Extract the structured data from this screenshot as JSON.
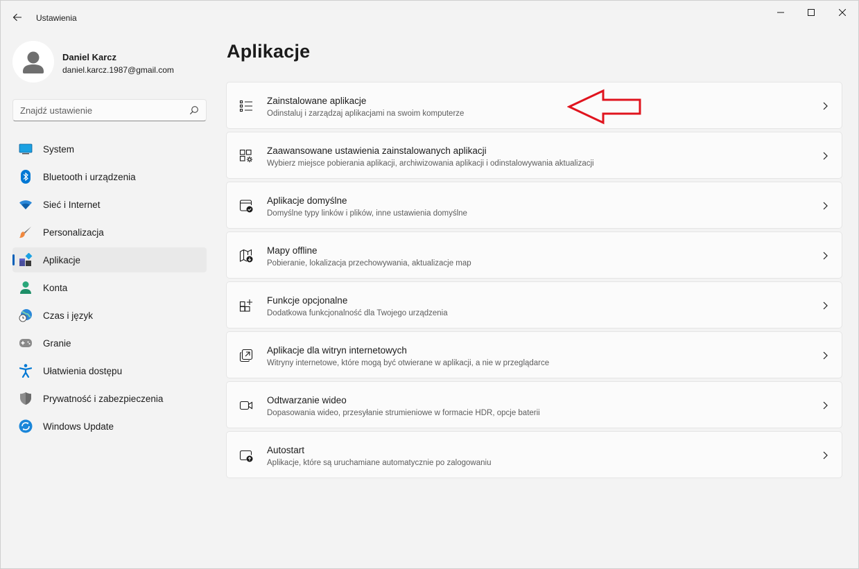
{
  "window": {
    "title": "Ustawienia"
  },
  "user": {
    "name": "Daniel Karcz",
    "email": "daniel.karcz.1987@gmail.com"
  },
  "search": {
    "placeholder": "Znajdź ustawienie"
  },
  "sidebar": {
    "items": [
      {
        "label": "System",
        "icon": "system-icon",
        "active": false
      },
      {
        "label": "Bluetooth i urządzenia",
        "icon": "bluetooth-icon",
        "active": false
      },
      {
        "label": "Sieć i Internet",
        "icon": "wifi-icon",
        "active": false
      },
      {
        "label": "Personalizacja",
        "icon": "brush-icon",
        "active": false
      },
      {
        "label": "Aplikacje",
        "icon": "apps-icon",
        "active": true
      },
      {
        "label": "Konta",
        "icon": "account-icon",
        "active": false
      },
      {
        "label": "Czas i język",
        "icon": "time-language-icon",
        "active": false
      },
      {
        "label": "Granie",
        "icon": "gamepad-icon",
        "active": false
      },
      {
        "label": "Ułatwienia dostępu",
        "icon": "accessibility-icon",
        "active": false
      },
      {
        "label": "Prywatność i zabezpieczenia",
        "icon": "shield-icon",
        "active": false
      },
      {
        "label": "Windows Update",
        "icon": "windows-update-icon",
        "active": false
      }
    ]
  },
  "main": {
    "title": "Aplikacje",
    "cards": [
      {
        "title": "Zainstalowane aplikacje",
        "subtitle": "Odinstaluj i zarządzaj aplikacjami na swoim komputerze",
        "icon": "list-icon"
      },
      {
        "title": "Zaawansowane ustawienia zainstalowanych aplikacji",
        "subtitle": "Wybierz miejsce pobierania aplikacji, archiwizowania aplikacji i odinstalowywania aktualizacji",
        "icon": "apps-settings-icon"
      },
      {
        "title": "Aplikacje domyślne",
        "subtitle": "Domyślne typy linków i plików, inne ustawienia domyślne",
        "icon": "default-apps-icon"
      },
      {
        "title": "Mapy offline",
        "subtitle": "Pobieranie, lokalizacja przechowywania, aktualizacje map",
        "icon": "offline-map-icon"
      },
      {
        "title": "Funkcje opcjonalne",
        "subtitle": "Dodatkowa funkcjonalność dla Twojego urządzenia",
        "icon": "optional-features-icon"
      },
      {
        "title": "Aplikacje dla witryn internetowych",
        "subtitle": "Witryny internetowe, które mogą być otwierane w aplikacji, a nie w przeglądarce",
        "icon": "open-external-icon"
      },
      {
        "title": "Odtwarzanie wideo",
        "subtitle": "Dopasowania wideo, przesyłanie strumieniowe w formacie HDR, opcje baterii",
        "icon": "video-icon"
      },
      {
        "title": "Autostart",
        "subtitle": "Aplikacje, które są uruchamiane automatycznie po zalogowaniu",
        "icon": "startup-icon"
      }
    ]
  },
  "colors": {
    "accent": "#005fb8",
    "annotation": "#e0141e"
  }
}
